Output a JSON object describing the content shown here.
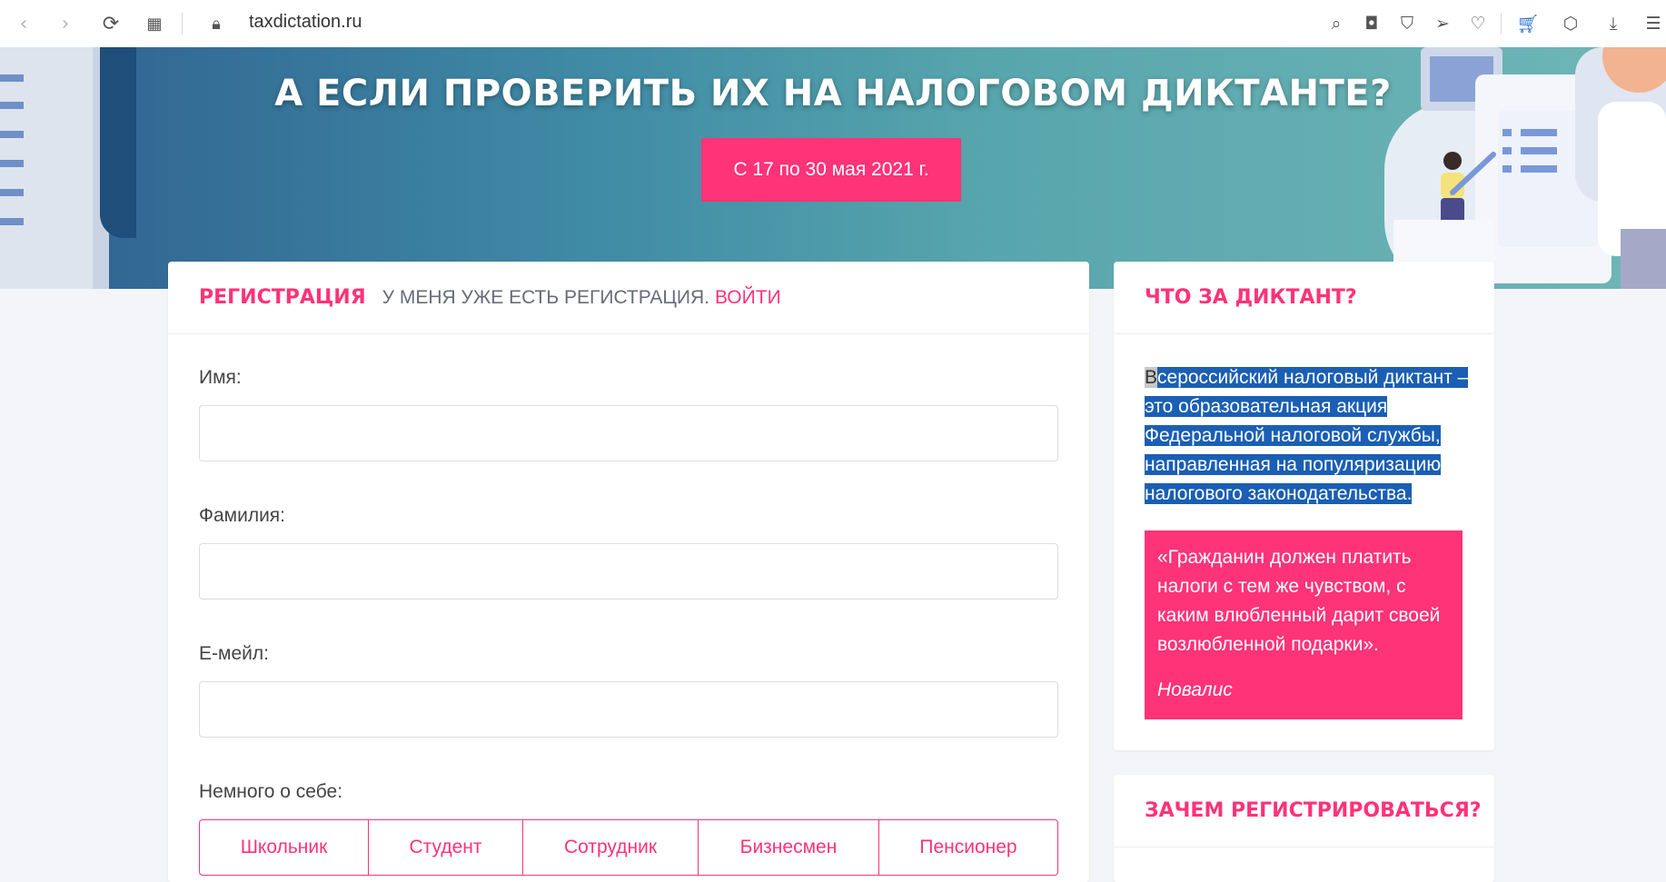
{
  "browser": {
    "url": "taxdictation.ru",
    "icons": [
      "back-icon",
      "forward-icon",
      "reload-icon",
      "tabs-grid-icon",
      "lock-icon",
      "zoom-search-icon",
      "camera-icon",
      "shield-icon",
      "send-icon",
      "heart-icon",
      "cart-icon",
      "box-icon",
      "download-icon",
      "settings-sliders-icon"
    ]
  },
  "hero": {
    "title": "А ЕСЛИ ПРОВЕРИТЬ ИХ НА НАЛОГОВОМ ДИКТАНТЕ?",
    "date_button": "С 17 по 30 мая 2021 г."
  },
  "registration": {
    "title": "РЕГИСТРАЦИЯ",
    "already_text": "У МЕНЯ УЖЕ ЕСТЬ РЕГИСТРАЦИЯ.",
    "login_link": "ВОЙТИ",
    "fields": [
      {
        "label": "Имя:",
        "value": ""
      },
      {
        "label": "Фамилия:",
        "value": ""
      },
      {
        "label": "Е-мейл:",
        "value": ""
      }
    ],
    "about_label": "Немного о себе:",
    "about_options": [
      "Школьник",
      "Студент",
      "Сотрудник",
      "Бизнесмен",
      "Пенсионер"
    ]
  },
  "about": {
    "title": "ЧТО ЗА ДИКТАНТ?",
    "first_letter": "В",
    "text_rest": "сероссийский налоговый диктант – это образовательная акция Федеральной налоговой службы, направленная на популяризацию налогового законодательства.",
    "quote": "«Гражданин должен платить налоги с тем же чувством, с каким влюбленный дарит своей возлюбленной подарки».",
    "quote_author": "Новалис"
  },
  "why": {
    "title": "ЗАЧЕМ РЕГИСТРИРОВАТЬСЯ?"
  },
  "colors": {
    "accent": "#ff3377",
    "selection": "#1a5fb4"
  }
}
